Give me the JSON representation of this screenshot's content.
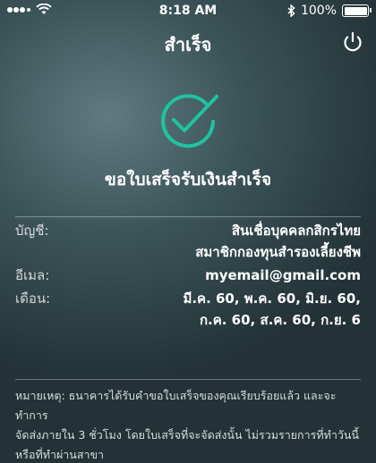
{
  "status_bar": {
    "time": "8:18 AM",
    "battery_text": "100%",
    "battery_level": 1.0,
    "icons": [
      "signal-dots-icon",
      "wifi-icon",
      "bluetooth-icon",
      "battery-icon"
    ]
  },
  "header": {
    "title": "สำเร็จ",
    "power_icon": "power-icon"
  },
  "result": {
    "icon": "check-circle-icon",
    "accent_color": "#1ec4a0",
    "message": "ขอใบเสร็จรับเงินสำเร็จ"
  },
  "details": {
    "account_label": "บัญชี:",
    "account_line1": "สินเชื่อบุคคลกสิกรไทย",
    "account_line2": "สมาชิกกองทุนสำรองเลี้ยงชีพ",
    "email_label": "อีเมล:",
    "email_value": "myemail@gmail.com",
    "month_label": "เดือน:",
    "month_line1": "มี.ค. 60, พ.ค. 60, มิ.ย. 60,",
    "month_line2": "ก.ค. 60, ส.ค. 60, ก.ย. 6"
  },
  "note": {
    "line1": "หมายเหตุ: ธนาคารได้รับคำขอใบเสร็จของคุณเรียบร้อยแล้ว และจะทำการ",
    "line2": "จัดส่งภายใน 3 ชั่วโมง โดยใบเสร็จที่จะจัดส่งนั้น ไม่รวมรายการที่ทำวันนี้",
    "line3": "หรือที่ทำผ่านสาขา"
  }
}
